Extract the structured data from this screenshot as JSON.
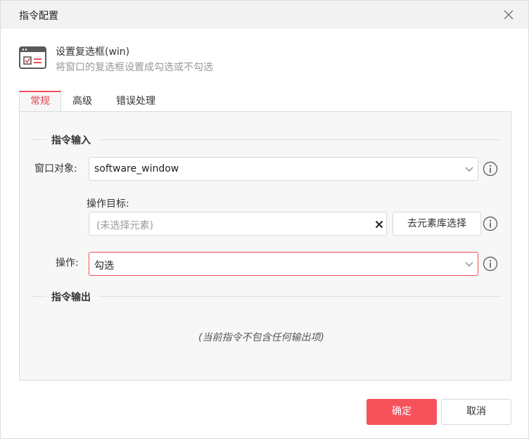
{
  "dialog": {
    "title": "指令配置",
    "close_icon": "close-icon"
  },
  "command": {
    "icon": "checkbox-window-icon",
    "name": "设置复选框(win)",
    "description": "将窗口的复选框设置成勾选或不勾选"
  },
  "tabs": [
    {
      "label": "常规",
      "active": true
    },
    {
      "label": "高级",
      "active": false
    },
    {
      "label": "错误处理",
      "active": false
    }
  ],
  "input_section": {
    "title": "指令输入",
    "window_object": {
      "label": "窗口对象:",
      "value": "software_window"
    },
    "operation_target": {
      "label": "操作目标:",
      "placeholder": "(未选择元素)",
      "library_button": "去元素库选择"
    },
    "operation": {
      "label": "操作:",
      "value": "勾选"
    }
  },
  "output_section": {
    "title": "指令输出",
    "empty_text": "(当前指令不包含任何输出项)"
  },
  "footer": {
    "ok_label": "确定",
    "cancel_label": "取消"
  },
  "colors": {
    "accent": "#f7525c",
    "active_tab_text": "#e8424c",
    "panel_bg": "#f7f7f7",
    "titlebar_bg": "#f2f2f2"
  }
}
